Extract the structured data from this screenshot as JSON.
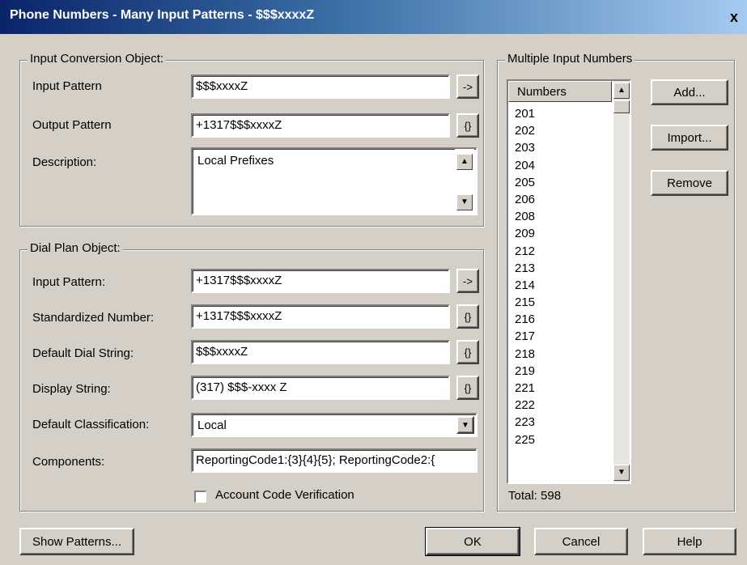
{
  "window": {
    "title": "Phone Numbers - Many Input Patterns - $$$xxxxZ",
    "close_label": "x"
  },
  "input_conversion": {
    "group_title": "Input Conversion Object:",
    "input_pattern_label": "Input Pattern",
    "input_pattern_value": "$$$xxxxZ",
    "input_pattern_btn": "->",
    "output_pattern_label": "Output Pattern",
    "output_pattern_value": "+1317$$$xxxxZ",
    "output_pattern_btn": "{}",
    "description_label": "Description:",
    "description_value": "Local Prefixes"
  },
  "dial_plan": {
    "group_title": "Dial Plan Object:",
    "input_pattern_label": "Input Pattern:",
    "input_pattern_value": "+1317$$$xxxxZ",
    "input_pattern_btn": "->",
    "standardized_label": "Standardized Number:",
    "standardized_value": "+1317$$$xxxxZ",
    "standardized_btn": "{}",
    "default_dial_label": "Default Dial String:",
    "default_dial_value": "$$$xxxxZ",
    "default_dial_btn": "{}",
    "display_string_label": "Display String:",
    "display_string_value": "(317) $$$-xxxx Z",
    "display_string_btn": "{}",
    "classification_label": "Default Classification:",
    "classification_value": "Local",
    "components_label": "Components:",
    "components_value": "ReportingCode1:{3}{4}{5}; ReportingCode2:{",
    "account_code_label": "Account Code Verification",
    "account_code_checked": false
  },
  "multiple_input": {
    "group_title": "Multiple Input Numbers",
    "list_header": "Numbers",
    "numbers": [
      "201",
      "202",
      "203",
      "204",
      "205",
      "206",
      "208",
      "209",
      "212",
      "213",
      "214",
      "215",
      "216",
      "217",
      "218",
      "219",
      "221",
      "222",
      "223",
      "225"
    ],
    "total_label": "Total: 598",
    "add_label": "Add...",
    "import_label": "Import...",
    "remove_label": "Remove"
  },
  "footer": {
    "show_patterns_label": "Show Patterns...",
    "ok_label": "OK",
    "cancel_label": "Cancel",
    "help_label": "Help"
  }
}
